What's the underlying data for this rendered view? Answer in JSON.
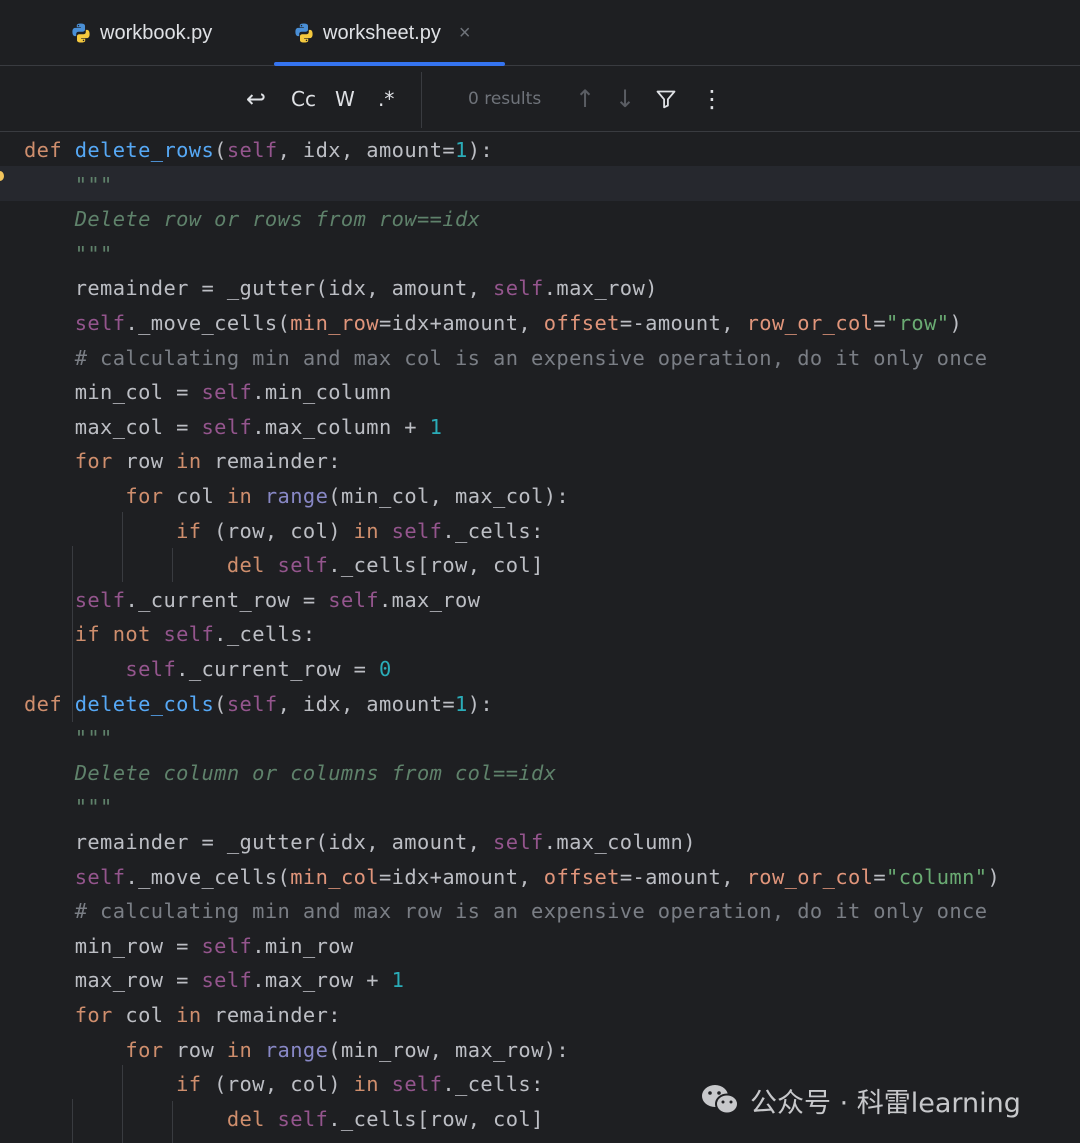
{
  "tabs": [
    {
      "label": "workbook.py",
      "active": false
    },
    {
      "label": "worksheet.py",
      "active": true,
      "close": "×"
    }
  ],
  "find_toolbar": {
    "wrap_icon": "↩",
    "match_case": "Cc",
    "whole_words": "W",
    "regex": ".*",
    "results": "0 results",
    "prev_icon": "↑",
    "next_icon": "↓",
    "filter_icon": "filter-icon",
    "more_icon": "⋮"
  },
  "colors": {
    "background": "#1e1f22",
    "keyword": "#cf8e6d",
    "function": "#56a8f5",
    "self": "#94558d",
    "number": "#2aacb8",
    "string": "#6aab73",
    "docstring": "#5f826b",
    "comment": "#7a7e85",
    "parameter": "#e0957b",
    "accent": "#3574f0"
  },
  "code": [
    [
      [
        "kw",
        "def "
      ],
      [
        "fn",
        "delete_rows"
      ],
      [
        "",
        "("
      ],
      [
        "self",
        "self"
      ],
      [
        "",
        ", idx, amount="
      ],
      [
        "num",
        "1"
      ],
      [
        "",
        "):"
      ]
    ],
    [
      [
        "doc",
        "    \"\"\""
      ]
    ],
    [
      [
        "doc",
        "    Delete row or rows from row==idx"
      ]
    ],
    [
      [
        "doc",
        "    \"\"\""
      ]
    ],
    [
      [
        "",
        "    remainder = _gutter(idx, amount, "
      ],
      [
        "self",
        "self"
      ],
      [
        "",
        ".max_row)"
      ]
    ],
    [
      [
        "",
        "    "
      ],
      [
        "self",
        "self"
      ],
      [
        "",
        "._move_cells("
      ],
      [
        "param",
        "min_row"
      ],
      [
        "",
        "=idx+amount, "
      ],
      [
        "param",
        "offset"
      ],
      [
        "",
        "=-amount, "
      ],
      [
        "param",
        "row_or_col"
      ],
      [
        "",
        "="
      ],
      [
        "str",
        "\"row\""
      ],
      [
        "",
        ")"
      ]
    ],
    [
      [
        "cmt",
        "    # calculating min and max col is an expensive operation, do it only once"
      ]
    ],
    [
      [
        "",
        "    min_col = "
      ],
      [
        "self",
        "self"
      ],
      [
        "",
        ".min_column"
      ]
    ],
    [
      [
        "",
        "    max_col = "
      ],
      [
        "self",
        "self"
      ],
      [
        "",
        ".max_column + "
      ],
      [
        "num",
        "1"
      ]
    ],
    [
      [
        "kw",
        "    for "
      ],
      [
        "",
        "row "
      ],
      [
        "kw",
        "in "
      ],
      [
        "",
        "remainder:"
      ]
    ],
    [
      [
        "kw",
        "        for "
      ],
      [
        "",
        "col "
      ],
      [
        "kw",
        "in "
      ],
      [
        "builtin",
        "range"
      ],
      [
        "",
        "(min_col, max_col):"
      ]
    ],
    [
      [
        "kw",
        "            if "
      ],
      [
        "",
        "(row, col) "
      ],
      [
        "kw",
        "in "
      ],
      [
        "self",
        "self"
      ],
      [
        "",
        "._cells:"
      ]
    ],
    [
      [
        "kw",
        "                del "
      ],
      [
        "self",
        "self"
      ],
      [
        "",
        "._cells[row, col]"
      ]
    ],
    [
      [
        "",
        "    "
      ],
      [
        "self",
        "self"
      ],
      [
        "",
        "._current_row = "
      ],
      [
        "self",
        "self"
      ],
      [
        "",
        ".max_row"
      ]
    ],
    [
      [
        "kw",
        "    if not "
      ],
      [
        "self",
        "self"
      ],
      [
        "",
        "._cells:"
      ]
    ],
    [
      [
        "",
        "        "
      ],
      [
        "self",
        "self"
      ],
      [
        "",
        "._current_row = "
      ],
      [
        "num",
        "0"
      ]
    ],
    [
      [
        "kw",
        "def "
      ],
      [
        "fn",
        "delete_cols"
      ],
      [
        "",
        "("
      ],
      [
        "self",
        "self"
      ],
      [
        "",
        ", idx, amount="
      ],
      [
        "num",
        "1"
      ],
      [
        "",
        "):"
      ]
    ],
    [
      [
        "doc",
        "    \"\"\""
      ]
    ],
    [
      [
        "doc",
        "    Delete column or columns from col==idx"
      ]
    ],
    [
      [
        "doc",
        "    \"\"\""
      ]
    ],
    [
      [
        "",
        "    remainder = _gutter(idx, amount, "
      ],
      [
        "self",
        "self"
      ],
      [
        "",
        ".max_column)"
      ]
    ],
    [
      [
        "",
        "    "
      ],
      [
        "self",
        "self"
      ],
      [
        "",
        "._move_cells("
      ],
      [
        "param",
        "min_col"
      ],
      [
        "",
        "=idx+amount, "
      ],
      [
        "param",
        "offset"
      ],
      [
        "",
        "=-amount, "
      ],
      [
        "param",
        "row_or_col"
      ],
      [
        "",
        "="
      ],
      [
        "str",
        "\"column\""
      ],
      [
        "",
        ")"
      ]
    ],
    [
      [
        "cmt",
        "    # calculating min and max row is an expensive operation, do it only once"
      ]
    ],
    [
      [
        "",
        "    min_row = "
      ],
      [
        "self",
        "self"
      ],
      [
        "",
        ".min_row"
      ]
    ],
    [
      [
        "",
        "    max_row = "
      ],
      [
        "self",
        "self"
      ],
      [
        "",
        ".max_row + "
      ],
      [
        "num",
        "1"
      ]
    ],
    [
      [
        "kw",
        "    for "
      ],
      [
        "",
        "col "
      ],
      [
        "kw",
        "in "
      ],
      [
        "",
        "remainder:"
      ]
    ],
    [
      [
        "kw",
        "        for "
      ],
      [
        "",
        "row "
      ],
      [
        "kw",
        "in "
      ],
      [
        "builtin",
        "range"
      ],
      [
        "",
        "(min_row, max_row):"
      ]
    ],
    [
      [
        "kw",
        "            if "
      ],
      [
        "",
        "(row, col) "
      ],
      [
        "kw",
        "in "
      ],
      [
        "self",
        "self"
      ],
      [
        "",
        "._cells:"
      ]
    ],
    [
      [
        "kw",
        "                del "
      ],
      [
        "self",
        "self"
      ],
      [
        "",
        "._cells[row, col]"
      ]
    ]
  ],
  "watermark": {
    "text": "公众号 · 科雷learning",
    "icon": "wechat-icon"
  }
}
